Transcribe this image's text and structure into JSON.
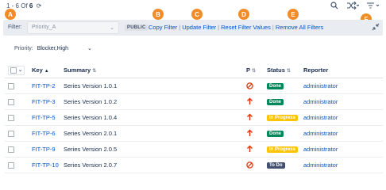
{
  "topbar": {
    "count_prefix": "1 - 6 Of",
    "count_total": "6"
  },
  "badges": {
    "a": "A",
    "b": "B",
    "c": "C",
    "d": "D",
    "e": "E",
    "f": "F"
  },
  "filter": {
    "label": "Filter:",
    "select_value": "Priority_A",
    "public_tag": "PUBLIC",
    "links": [
      "Copy Filter",
      "Update Filter",
      "Reset Filter Values",
      "Remove All Filters"
    ]
  },
  "priority": {
    "label": "Priority:",
    "value": "Blocker,High"
  },
  "table": {
    "headers": {
      "key": "Key",
      "summary": "Summary",
      "p": "P",
      "status": "Status",
      "reporter": "Reporter"
    },
    "rows": [
      {
        "key": "FIT-TP-2",
        "summary": "Series Version 1.0.1",
        "priority": "blocker",
        "status": "Done",
        "status_type": "done",
        "reporter": "administrator"
      },
      {
        "key": "FIT-TP-3",
        "summary": "Series Version 1.0.2",
        "priority": "high",
        "status": "Done",
        "status_type": "done",
        "reporter": "administrator"
      },
      {
        "key": "FIT-TP-5",
        "summary": "Series Version 1.0.4",
        "priority": "high",
        "status": "In Progress",
        "status_type": "inprogress",
        "reporter": "administrator"
      },
      {
        "key": "FIT-TP-6",
        "summary": "Series Version 2.0.1",
        "priority": "high",
        "status": "Done",
        "status_type": "done",
        "reporter": "administrator"
      },
      {
        "key": "FIT-TP-9",
        "summary": "Series Version 2.0.5",
        "priority": "high",
        "status": "In Progress",
        "status_type": "inprogress",
        "reporter": "administrator"
      },
      {
        "key": "FIT-TP-10",
        "summary": "Series Version 2.0.7",
        "priority": "blocker",
        "status": "To Do",
        "status_type": "todo",
        "reporter": "administrator"
      }
    ]
  },
  "colors": {
    "badge": "#f28c28",
    "link": "#0052cc",
    "done": "#00875a",
    "inprogress": "#ffc400",
    "todo": "#42526e",
    "priority_icon": "#de350b"
  }
}
